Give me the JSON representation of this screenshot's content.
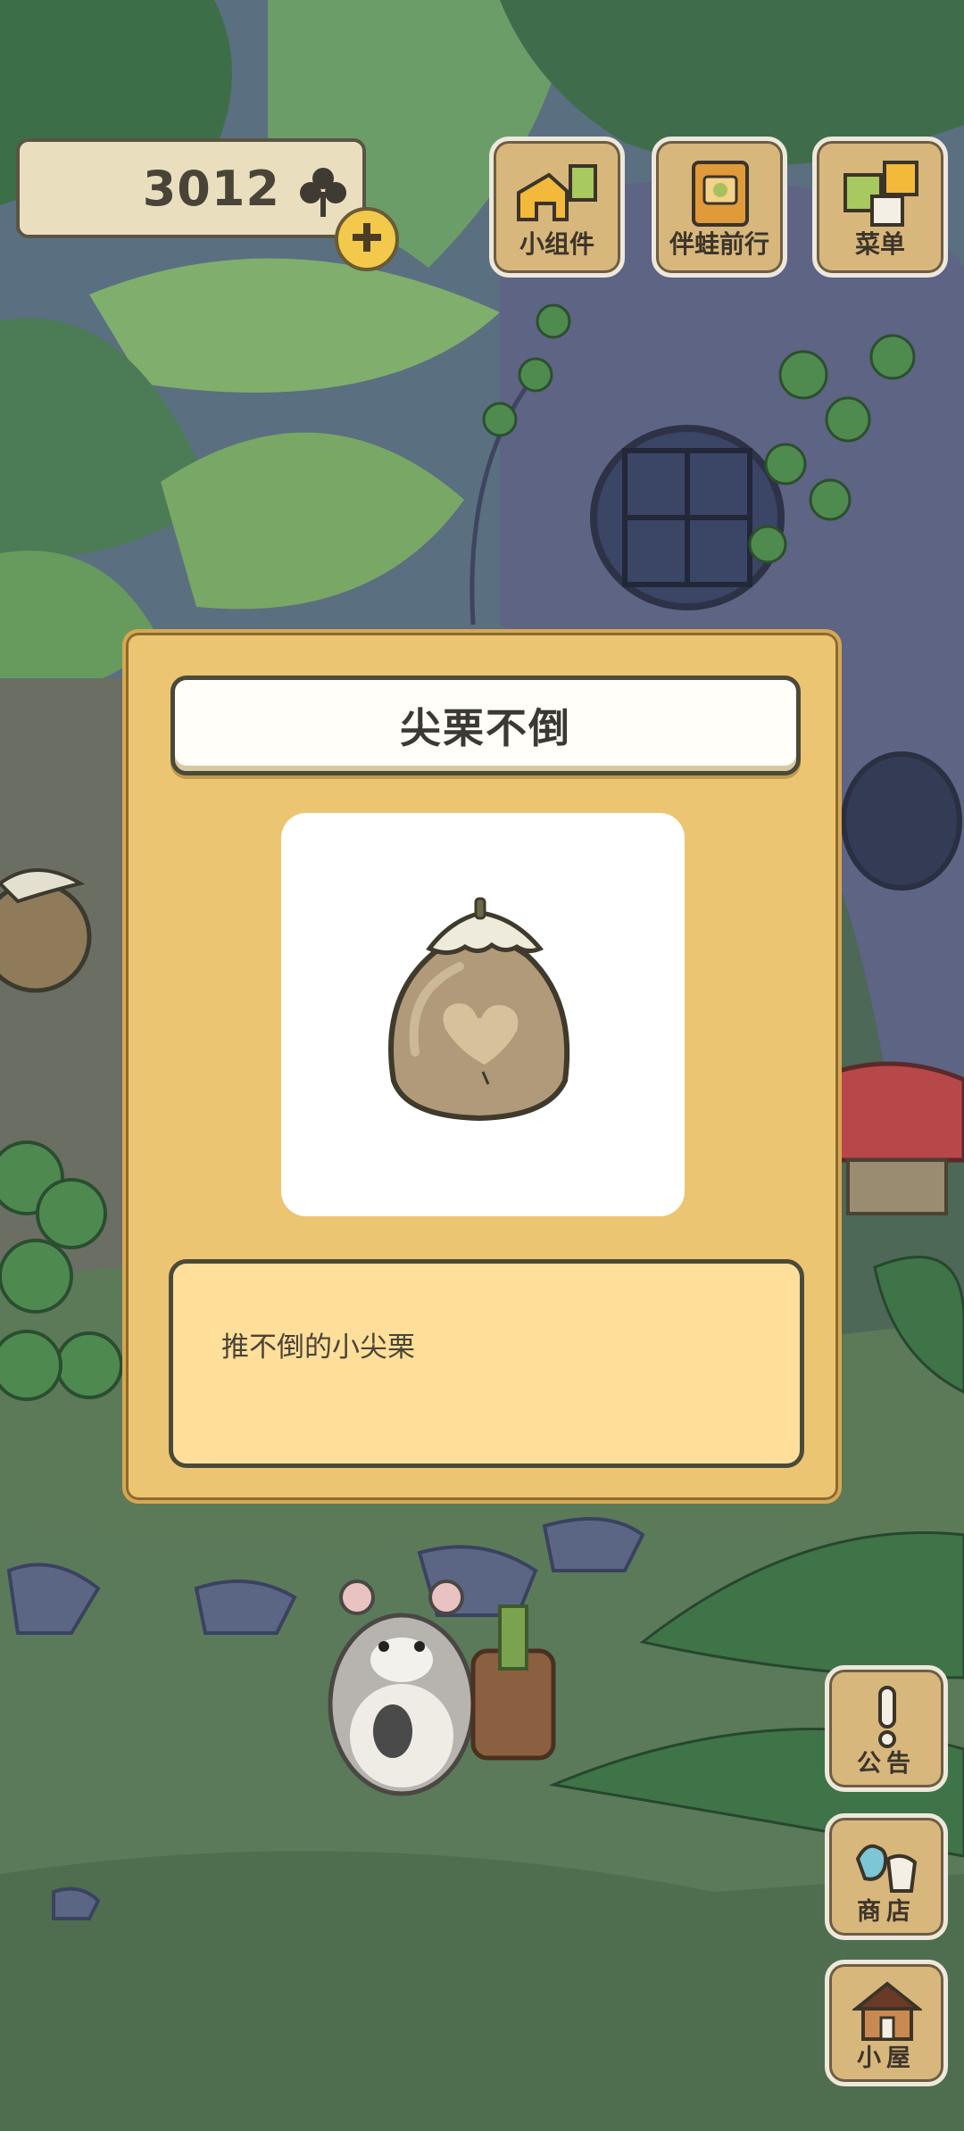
{
  "header": {
    "currency_value": "3012",
    "currency_icon": "clover-icon",
    "add_icon": "plus-icon"
  },
  "top_buttons": [
    {
      "label": "小组件",
      "icon": "widget-icon"
    },
    {
      "label": "伴蛙前行",
      "icon": "journal-icon"
    },
    {
      "label": "菜单",
      "icon": "menu-icon"
    }
  ],
  "side_buttons": [
    {
      "label": "公告",
      "icon": "exclamation-icon"
    },
    {
      "label": "商店",
      "icon": "shop-bags-icon"
    },
    {
      "label": "小屋",
      "icon": "house-icon"
    }
  ],
  "dialog": {
    "title": "尖栗不倒",
    "item_icon": "chestnut-tumbler-icon",
    "description": "推不倒的小尖栗"
  },
  "colors": {
    "dialog_bg": "#ecc572",
    "desc_bg": "#ffdf9a",
    "button_wood": "#d8b77c"
  }
}
